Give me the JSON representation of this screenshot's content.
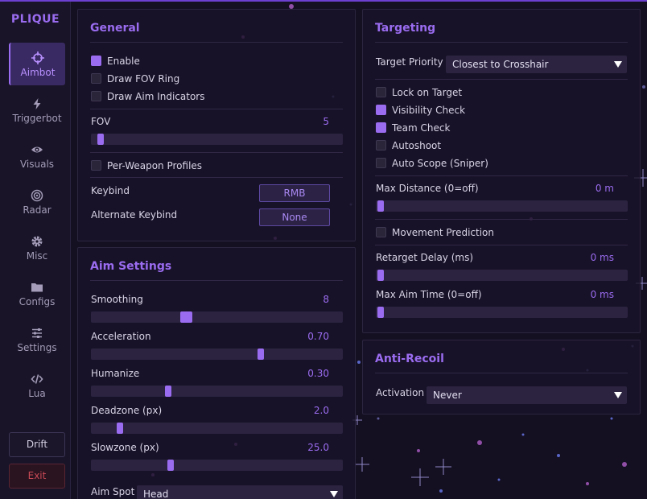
{
  "app": {
    "logo": "PLIQUE"
  },
  "sidebar": {
    "items": [
      {
        "label": "Aimbot",
        "icon": "crosshair-icon"
      },
      {
        "label": "Triggerbot",
        "icon": "lightning-icon"
      },
      {
        "label": "Visuals",
        "icon": "eye-icon"
      },
      {
        "label": "Radar",
        "icon": "radar-icon"
      },
      {
        "label": "Misc",
        "icon": "gear-icon"
      },
      {
        "label": "Configs",
        "icon": "folder-icon"
      },
      {
        "label": "Settings",
        "icon": "sliders-icon"
      },
      {
        "label": "Lua",
        "icon": "code-icon"
      }
    ],
    "active": "Aimbot",
    "drift_label": "Drift",
    "exit_label": "Exit"
  },
  "general": {
    "title": "General",
    "enable": {
      "label": "Enable",
      "checked": true
    },
    "draw_fov_ring": {
      "label": "Draw FOV Ring",
      "checked": false
    },
    "draw_aim_indicators": {
      "label": "Draw Aim Indicators",
      "checked": false
    },
    "fov": {
      "label": "FOV",
      "value": "5",
      "fraction": 0.02
    },
    "per_weapon_profiles": {
      "label": "Per-Weapon Profiles",
      "checked": false
    },
    "keybind": {
      "label": "Keybind",
      "value": "RMB"
    },
    "alternate_keybind": {
      "label": "Alternate Keybind",
      "value": "None"
    }
  },
  "aim_settings": {
    "title": "Aim Settings",
    "smoothing": {
      "label": "Smoothing",
      "value": "8",
      "fraction": 0.37
    },
    "acceleration": {
      "label": "Acceleration",
      "value": "0.70",
      "fraction": 0.68
    },
    "humanize": {
      "label": "Humanize",
      "value": "0.30",
      "fraction": 0.3
    },
    "deadzone": {
      "label": "Deadzone (px)",
      "value": "2.0",
      "fraction": 0.1
    },
    "slowzone": {
      "label": "Slowzone (px)",
      "value": "25.0",
      "fraction": 0.31
    },
    "aim_spot": {
      "label": "Aim Spot",
      "value": "Head"
    }
  },
  "targeting": {
    "title": "Targeting",
    "target_priority": {
      "label": "Target Priority",
      "value": "Closest to Crosshair"
    },
    "lock_on_target": {
      "label": "Lock on Target",
      "checked": false
    },
    "visibility_check": {
      "label": "Visibility Check",
      "checked": true
    },
    "team_check": {
      "label": "Team Check",
      "checked": true
    },
    "autoshoot": {
      "label": "Autoshoot",
      "checked": false
    },
    "auto_scope": {
      "label": "Auto Scope (Sniper)",
      "checked": false
    },
    "max_distance": {
      "label": "Max Distance (0=off)",
      "value": "0 m",
      "fraction": 0.0
    },
    "movement_prediction": {
      "label": "Movement Prediction",
      "checked": false
    },
    "retarget_delay": {
      "label": "Retarget Delay (ms)",
      "value": "0 ms",
      "fraction": 0.0
    },
    "max_aim_time": {
      "label": "Max Aim Time (0=off)",
      "value": "0 ms",
      "fraction": 0.0
    }
  },
  "anti_recoil": {
    "title": "Anti-Recoil",
    "activation": {
      "label": "Activation",
      "value": "Never"
    }
  },
  "colors": {
    "accent": "#9a6cf0",
    "background": "#150f22",
    "panel": "#1a1429",
    "exit": "#c84a55"
  }
}
